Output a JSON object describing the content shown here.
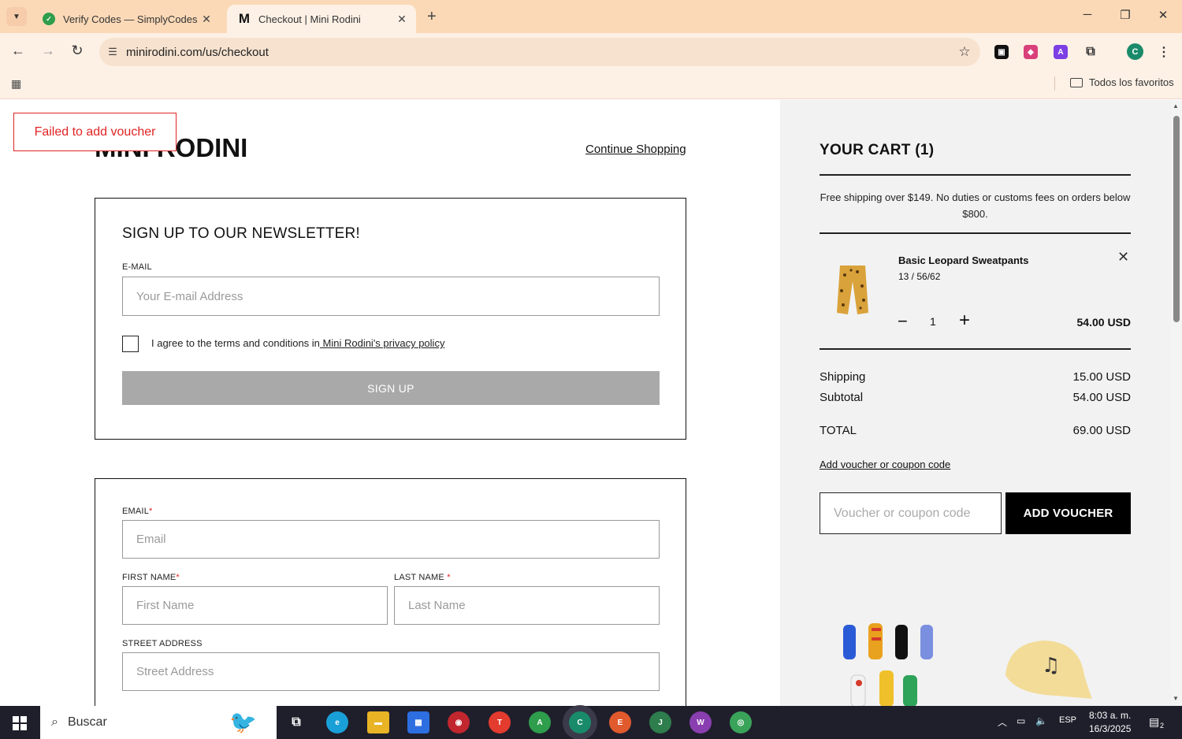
{
  "browser": {
    "tabs": [
      {
        "title": "Verify Codes — SimplyCodes",
        "active": false
      },
      {
        "title": "Checkout | Mini Rodini",
        "active": true
      }
    ],
    "url": "minirodini.com/us/checkout",
    "profile_initial": "C",
    "bookmarks_folder": "Todos los favoritos"
  },
  "page": {
    "toast": "Failed to add voucher",
    "logo": "MINI RODINI",
    "continue_shopping": "Continue Shopping",
    "newsletter": {
      "title": "SIGN UP TO OUR NEWSLETTER!",
      "email_label": "E-MAIL",
      "email_placeholder": "Your E-mail Address",
      "agree_text": "I agree to the terms and conditions in",
      "agree_link": " Mini Rodini's privacy policy",
      "signup_label": "SIGN UP"
    },
    "form": {
      "email_label": "EMAIL",
      "email_placeholder": "Email",
      "first_name_label": "FIRST NAME",
      "first_name_placeholder": "First Name",
      "last_name_label": "LAST NAME",
      "last_name_placeholder": "Last Name",
      "street_label": "STREET ADDRESS",
      "street_placeholder": "Street Address",
      "required_mark": "*"
    }
  },
  "cart": {
    "title": "YOUR CART (1)",
    "shipping_note": "Free shipping over $149. No duties or customs fees on orders below $800.",
    "item": {
      "name": "Basic Leopard Sweatpants",
      "variant": "13 / 56/62",
      "quantity": "1",
      "price": "54.00 USD"
    },
    "shipping_label": "Shipping",
    "shipping_value": "15.00 USD",
    "subtotal_label": "Subtotal",
    "subtotal_value": "54.00 USD",
    "total_label": "TOTAL",
    "total_value": "69.00 USD",
    "voucher_link": "Add voucher or coupon code",
    "voucher_placeholder": "Voucher or coupon code",
    "voucher_button": "ADD VOUCHER"
  },
  "taskbar": {
    "search": "Buscar",
    "language": "ESP",
    "time": "8:03 a. m.",
    "date": "16/3/2025",
    "notifications": "2"
  },
  "colors": {
    "tab_bar": "#fbd9b7",
    "toolbar": "#fdf1e6",
    "error": "#e02424",
    "button_disabled": "#a9a9a9",
    "cart_bg": "#f2f2f2"
  }
}
